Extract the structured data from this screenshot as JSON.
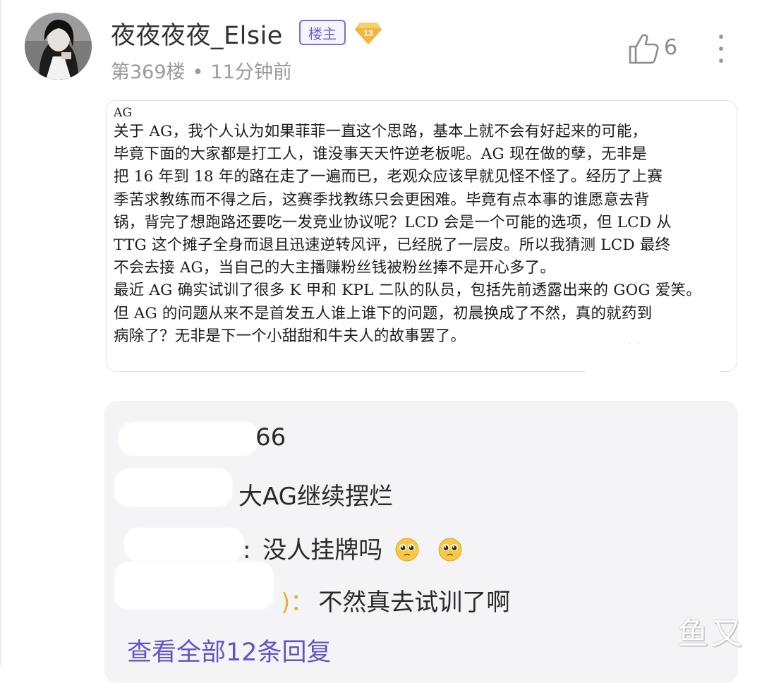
{
  "post": {
    "username": "夜夜夜夜_Elsie",
    "host_badge": "楼主",
    "level": "13",
    "floor": "第369楼",
    "separator": "•",
    "time": "11分钟前",
    "likes": "6"
  },
  "quote": {
    "title": "AG",
    "lines": [
      "关于 AG，我个人认为如果菲菲一直这个思路，基本上就不会有好起来的可能，",
      "毕竟下面的大家都是打工人，谁没事天天忤逆老板呢。AG 现在做的孽，无非是",
      "把 16 年到 18 年的路在走了一遍而已，老观众应该早就见怪不怪了。经历了上赛",
      "季苦求教练而不得之后，这赛季找教练只会更困难。毕竟有点本事的谁愿意去背",
      "锅，背完了想跑路还要吃一发竞业协议呢？LCD 会是一个可能的选项，但 LCD 从",
      "TTG 这个摊子全身而退且迅速逆转风评，已经脱了一层皮。所以我猜测 LCD 最终",
      "不会去接 AG，当自己的大主播赚粉丝钱被粉丝捧不是开心多了。",
      "最近 AG 确实试训了很多 K 甲和 KPL 二队的队员，包括先前透露出来的 GOG 爱笑。",
      "但 AG 的问题从来不是首发五人谁上谁下的问题，初晨换成了不然，真的就药到",
      "病除了？无非是下一个小甜甜和牛夫人的故事罢了。"
    ],
    "mark": "· ·"
  },
  "replies": [
    {
      "suffix": "66",
      "text": ""
    },
    {
      "suffix": "",
      "text": "大AG继续摆烂"
    },
    {
      "suffix": ":",
      "text": "没人挂牌吗"
    },
    {
      "suffix": ")：",
      "text": "不然真去试训了啊"
    }
  ],
  "view_all": "查看全部12条回复",
  "watermark": "鱼又",
  "colors": {
    "accent": "#6a5fd8",
    "level_badge": "#f3b53a",
    "reply_bg": "#f4f4f6"
  },
  "icons": {
    "like": "thumbs-up-icon",
    "more": "more-vertical-icon",
    "level": "diamond-level-icon",
    "emoji": "pleading-face-icon"
  }
}
